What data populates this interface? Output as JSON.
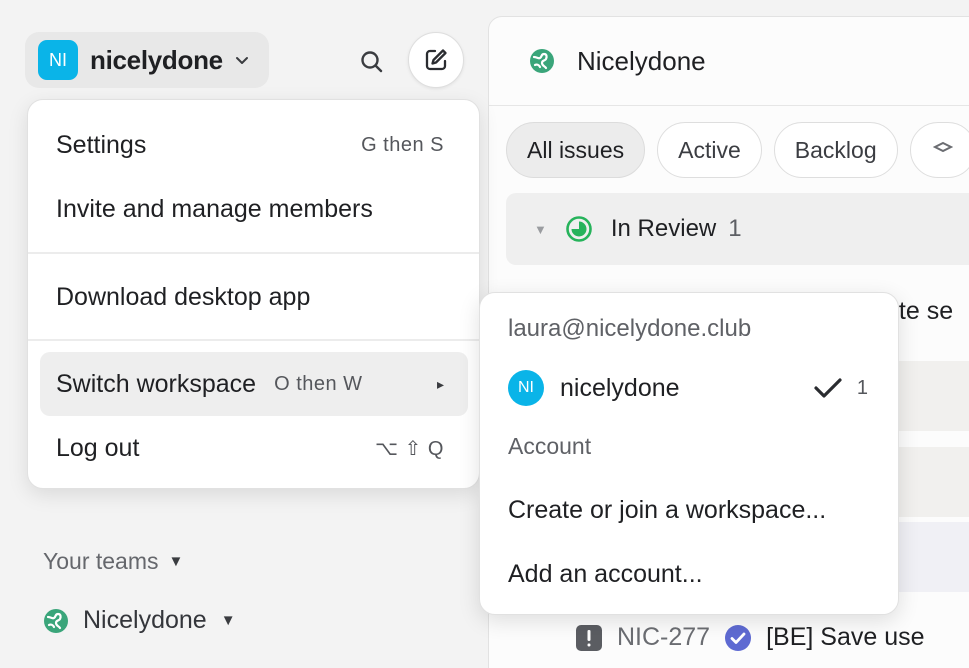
{
  "workspace": {
    "avatar_initials": "NI",
    "name": "nicelydone"
  },
  "icons": {
    "chevron": "chevron-down-icon",
    "search": "search-icon",
    "compose": "compose-icon",
    "team": "globe-icon",
    "status": "in-review-status-icon",
    "check": "check-icon",
    "priority": "urgent-priority-icon",
    "issue_status": "done-status-icon"
  },
  "colors": {
    "accent": "#0ab4e8",
    "team": "#3aa57a",
    "status_review": "#26b35b",
    "check": "#5e6ad2"
  },
  "sidebar": {
    "teams_heading": "Your teams",
    "teams_toggle": "▼",
    "teams": [
      {
        "name": "Nicelydone",
        "toggle": "▼"
      }
    ]
  },
  "menu": {
    "items": [
      {
        "label": "Settings",
        "shortcut": "G then S"
      },
      {
        "label": "Invite and manage members"
      },
      {
        "label": "Download desktop app"
      },
      {
        "label": "Switch workspace",
        "shortcut": "O then W",
        "arrow": "▸"
      },
      {
        "label": "Log out",
        "shortcut": "⌥ ⇧ Q"
      }
    ]
  },
  "submenu": {
    "email": "laura@nicelydone.club",
    "workspace": {
      "avatar_initials": "NI",
      "name": "nicelydone",
      "check": "✓",
      "shortcut": "1"
    },
    "section": "Account",
    "items": [
      "Create or join a workspace...",
      "Add an account..."
    ]
  },
  "main": {
    "title": "Nicelydone",
    "filters": [
      "All issues",
      "Active",
      "Backlog"
    ],
    "group": {
      "toggle": "▼",
      "label": "In Review",
      "count": "1"
    },
    "fragment_text": "ate se",
    "issue": {
      "id": "NIC-277",
      "title": "[BE] Save use"
    }
  }
}
